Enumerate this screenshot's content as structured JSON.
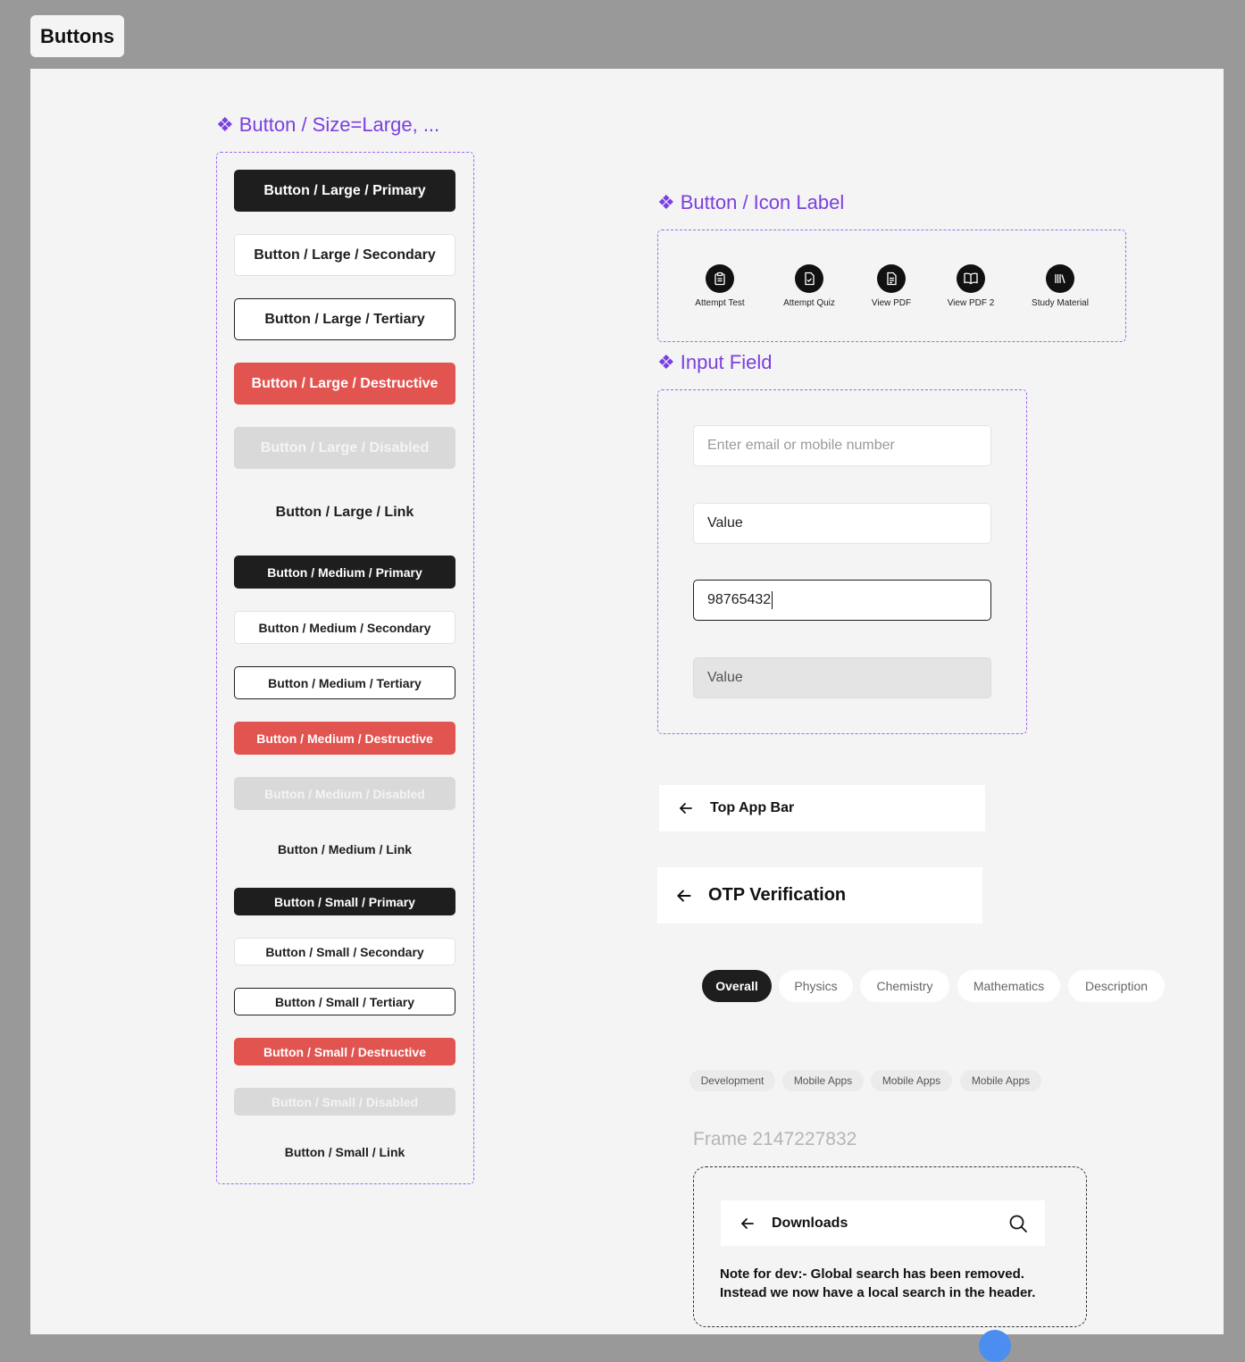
{
  "page_tab": "Buttons",
  "button_set": {
    "title": "Button / Size=Large, ...",
    "large": {
      "primary": "Button / Large / Primary",
      "secondary": "Button / Large / Secondary",
      "tertiary": "Button / Large / Tertiary",
      "destructive": "Button / Large / Destructive",
      "disabled": "Button / Large / Disabled",
      "link": "Button / Large / Link"
    },
    "medium": {
      "primary": "Button / Medium / Primary",
      "secondary": "Button / Medium / Secondary",
      "tertiary": "Button / Medium / Tertiary",
      "destructive": "Button / Medium / Destructive",
      "disabled": "Button / Medium / Disabled",
      "link": "Button / Medium / Link"
    },
    "small": {
      "primary": "Button / Small / Primary",
      "secondary": "Button / Small / Secondary",
      "tertiary": "Button / Small / Tertiary",
      "destructive": "Button /  Small / Destructive",
      "disabled": "Button / Small / Disabled",
      "link": "Button / Small / Link"
    }
  },
  "icon_label": {
    "title": "Button / Icon Label",
    "items": [
      {
        "label": "Attempt Test",
        "icon": "clipboard-icon"
      },
      {
        "label": "Attempt Quiz",
        "icon": "quiz-doc-icon"
      },
      {
        "label": "View PDF",
        "icon": "pdf-doc-icon"
      },
      {
        "label": "View PDF 2",
        "icon": "open-book-icon"
      },
      {
        "label": "Study Material",
        "icon": "library-icon"
      }
    ]
  },
  "input_field": {
    "title": "Input Field",
    "placeholder": "Enter email or mobile number",
    "value_filled": "Value",
    "value_focused": "98765432",
    "value_disabled": "Value"
  },
  "top_app_bar": {
    "title": "Top App Bar"
  },
  "otp_bar": {
    "title": "OTP Verification"
  },
  "chips": [
    "Overall",
    "Physics",
    "Chemistry",
    "Mathematics",
    "Description"
  ],
  "tags": [
    "Development",
    "Mobile Apps",
    "Mobile Apps",
    "Mobile Apps"
  ],
  "frame": {
    "title": "Frame 2147227832",
    "header_title": "Downloads",
    "note_line1": "Note for dev:-  Global search has been removed.",
    "note_line2": "Instead we now have a local search in the header."
  },
  "colors": {
    "accent": "#7b3fe0",
    "primary": "#1e1e1e",
    "destructive": "#e25450",
    "disabled": "#d9d9d9"
  }
}
